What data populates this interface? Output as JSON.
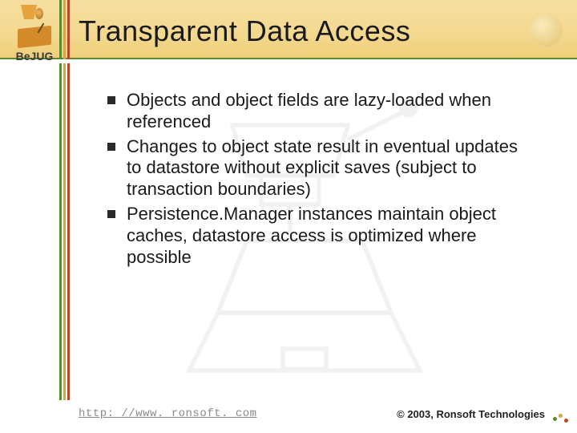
{
  "logo_text": "BeJUG",
  "title": "Transparent Data Access",
  "bullets": [
    "Objects and object fields are lazy-loaded when referenced",
    "Changes to object state result in eventual updates to datastore without explicit saves (subject to transaction boundaries)",
    "Persistence.Manager instances maintain object caches, datastore access is optimized where possible"
  ],
  "footer": {
    "url": "http: //www. ronsoft. com",
    "copyright": "© 2003, Ronsoft Technologies"
  }
}
